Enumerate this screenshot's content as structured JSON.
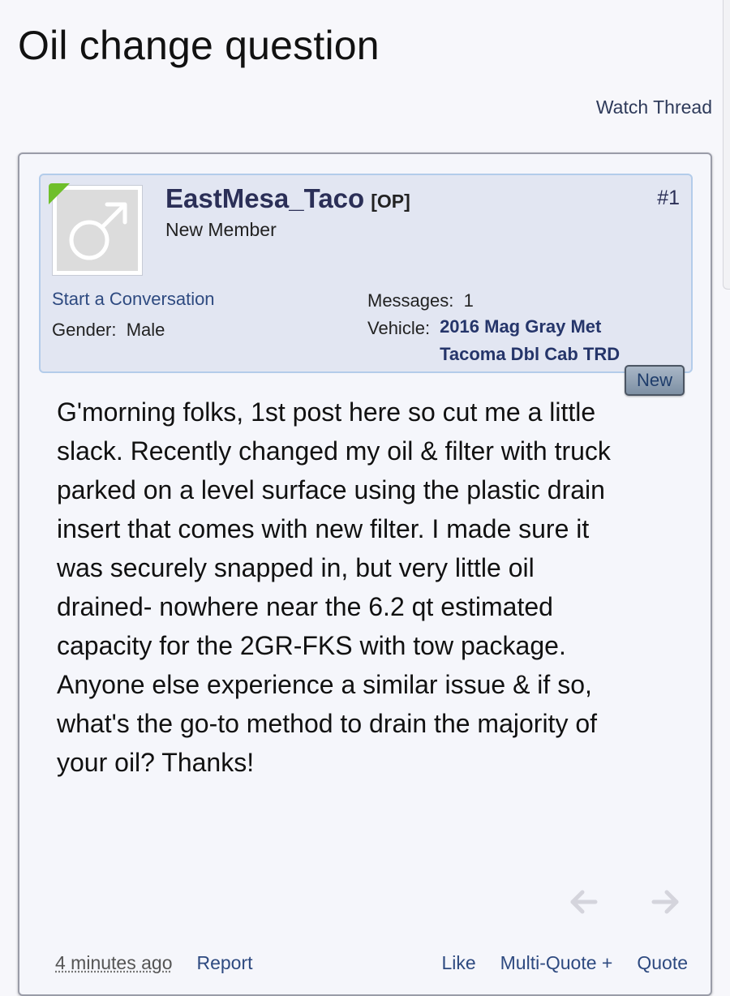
{
  "thread": {
    "title": "Oil change question",
    "watch_label": "Watch Thread"
  },
  "post": {
    "number": "#1",
    "user": {
      "name": "EastMesa_Taco",
      "op_tag": "[OP]",
      "title": "New Member",
      "avatar_icon": "male-symbol-icon",
      "online_color": "#6fbf2b"
    },
    "start_conversation": "Start a Conversation",
    "gender": {
      "label": "Gender:",
      "value": "Male"
    },
    "messages": {
      "label": "Messages:",
      "value": "1"
    },
    "vehicle": {
      "label": "Vehicle:",
      "value": "2016 Mag Gray Met Tacoma Dbl Cab TRD"
    },
    "new_badge": "New",
    "body": {
      "paragraph1": "G'morning folks, 1st post here so cut me a little slack. Recently changed my oil & filter with truck parked on a level surface using the plastic drain insert that comes with new filter. I made sure it was securely snapped in, but very little oil drained- nowhere near the 6.2 qt estimated capacity for the 2GR-FKS with tow package.",
      "paragraph2": "Anyone else experience a similar issue & if so, what's the go-to method to drain the majority of your oil? Thanks!"
    },
    "footer": {
      "date": "4 minutes ago",
      "report": "Report",
      "like": "Like",
      "multi_quote": "Multi-Quote +",
      "quote": "Quote"
    }
  },
  "colors": {
    "accent": "#2b2f57",
    "link": "#2e4a80",
    "user_block_bg": "#e2e6f2",
    "user_block_border": "#b3ccea"
  }
}
